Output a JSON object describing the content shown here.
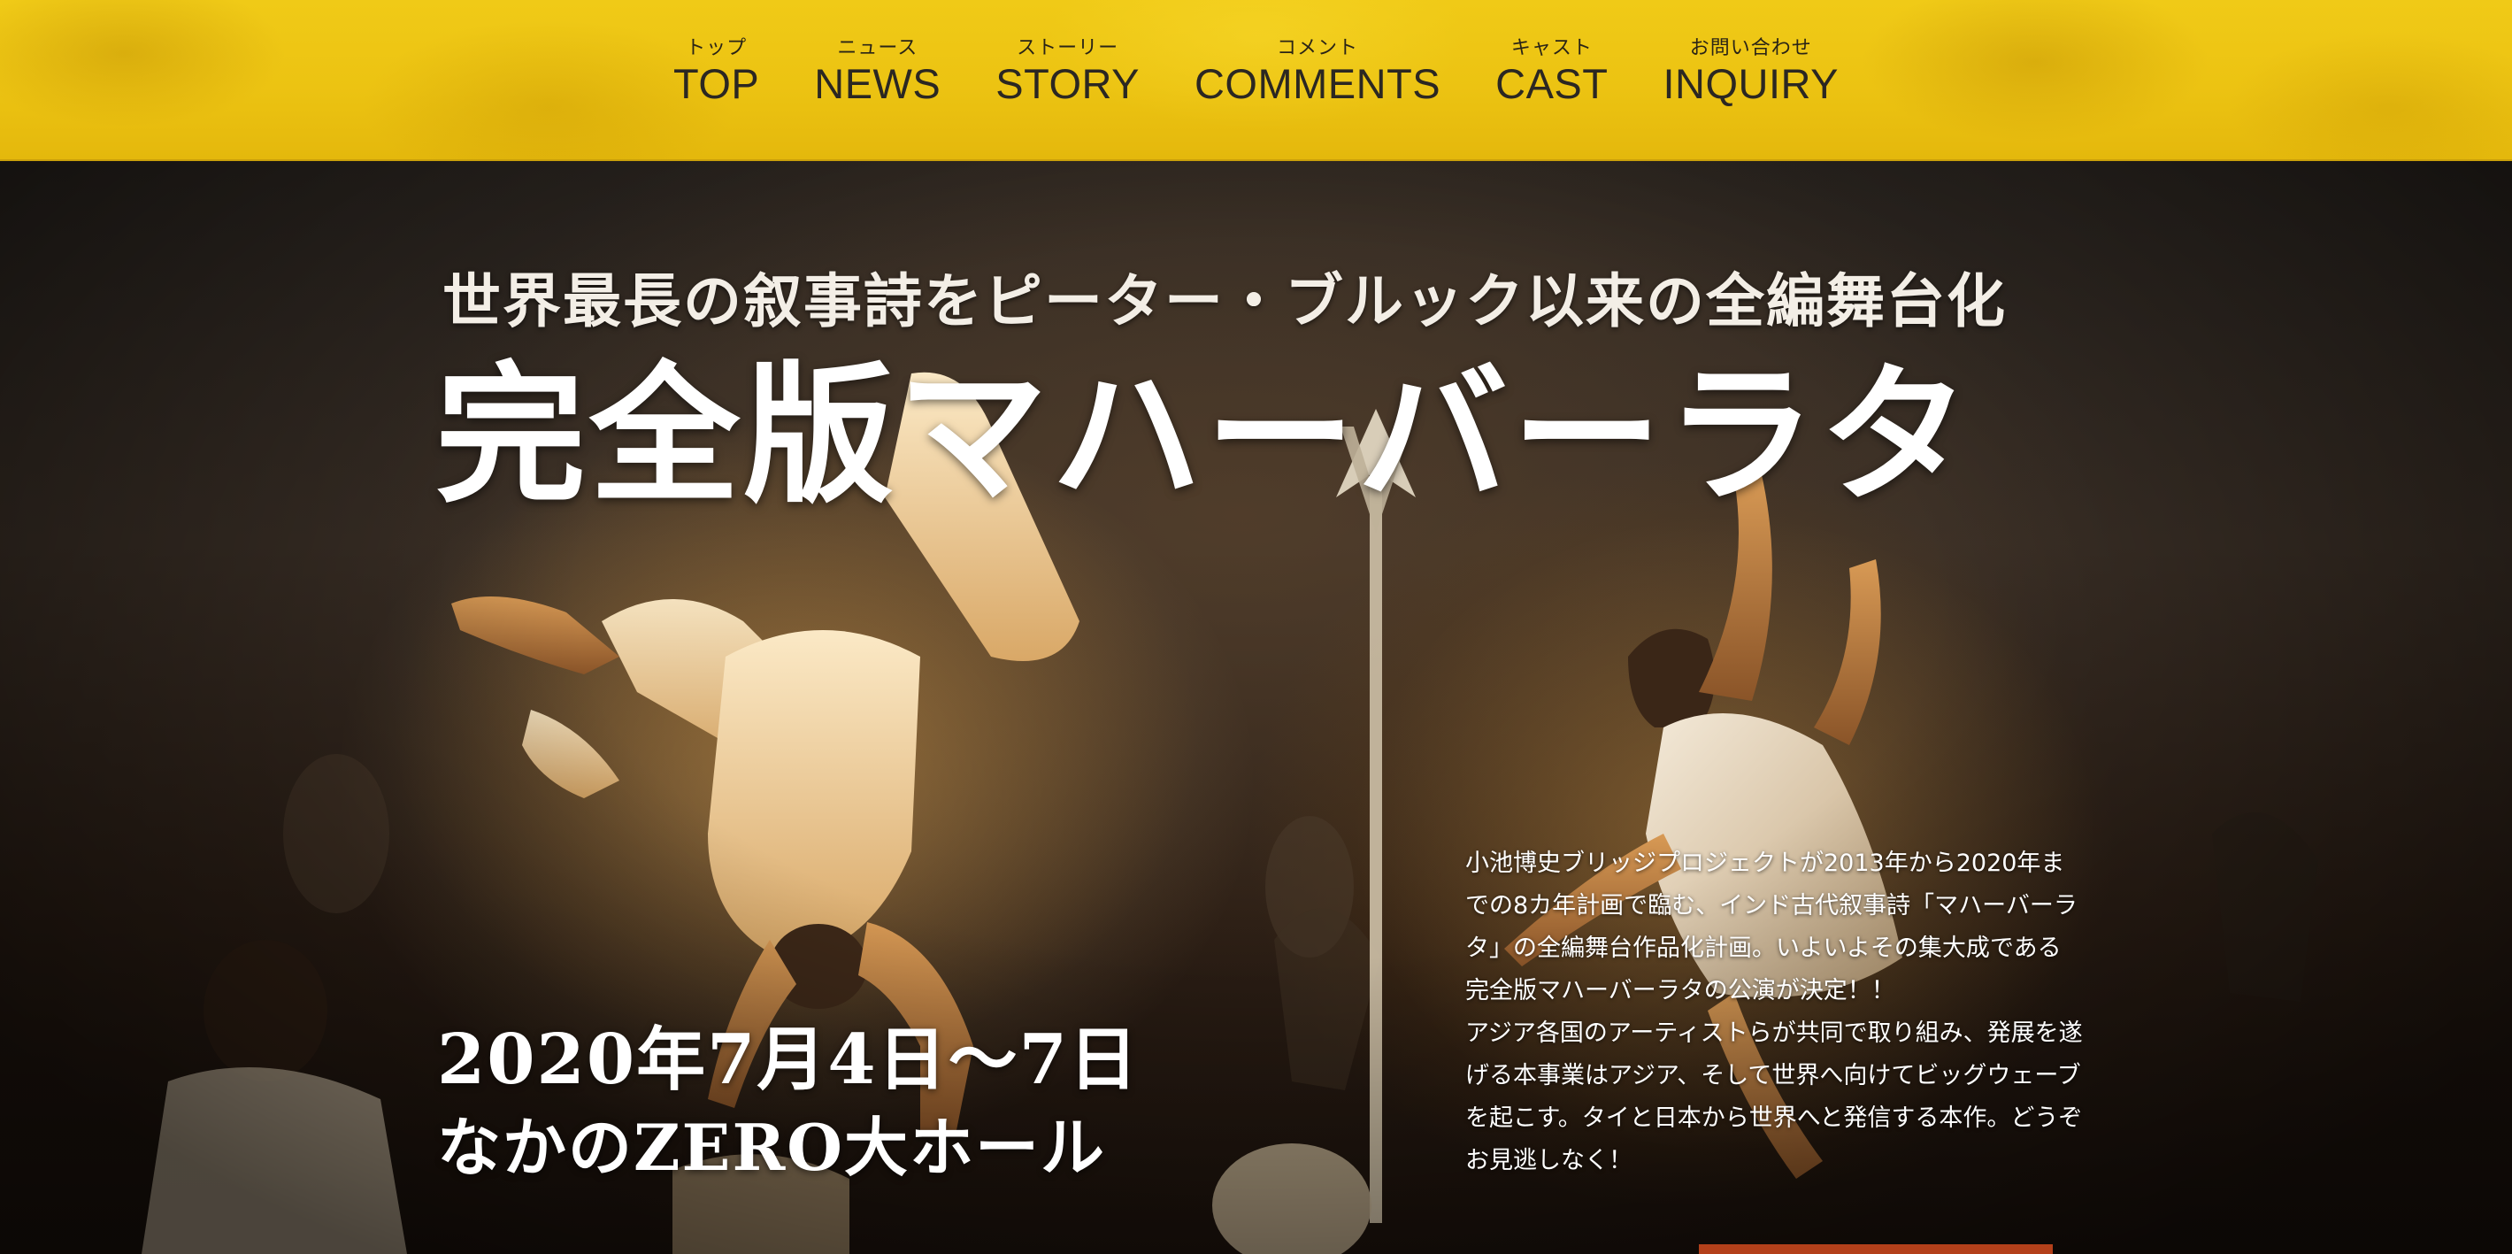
{
  "nav": {
    "items": [
      {
        "ruby": "トップ",
        "label": "TOP"
      },
      {
        "ruby": "ニュース",
        "label": "NEWS"
      },
      {
        "ruby": "ストーリー",
        "label": "STORY"
      },
      {
        "ruby": "コメント",
        "label": "COMMENTS"
      },
      {
        "ruby": "キャスト",
        "label": "CAST"
      },
      {
        "ruby": "お問い合わせ",
        "label": "INQUIRY"
      }
    ]
  },
  "hero": {
    "tagline": "世界最長の叙事詩をピーター・ブルック以来の全編舞台化",
    "title": "完全版マハーバーラタ",
    "date": "2020年7月4日〜7日",
    "venue": "なかのZERO大ホール",
    "intro": [
      "小池博史ブリッジプロジェクトが2013年から2020年までの8カ年計画で臨む、インド古代叙事詩「マハーバーラタ」の全編舞台作品化計画。いよいよその集大成である完全版マハーバーラタの公演が決定！！",
      "アジア各国のアーティストらが共同で取り組み、発展を遂げる本事業はアジア、そして世界へ向けてビッグウェーブを起こす。タイと日本から世界へと発信する本作。どうぞお見逃しなく！"
    ]
  },
  "colors": {
    "nav_background": "#ecc312",
    "nav_text": "#2b2722",
    "hero_text": "#ffffff",
    "cta_accent": "#b3401a"
  }
}
